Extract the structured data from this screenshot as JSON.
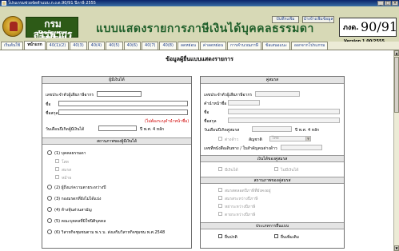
{
  "window": {
    "title": "โปรแกรมช่วยจัดทำแบบ ภ.ง.ด.90/91 ปีภาษี 2555"
  },
  "banner": {
    "org_th": "กรมสรรพากร",
    "org_en": "The Revenue Department",
    "form_title": "แบบแสดงรายการภาษีเงินได้บุคคลธรรมดา",
    "form_code_prefix": "ภงด.",
    "form_code": "90/91",
    "save_label": "บันทึกแฟ้ม",
    "attach_label": "นำเข้าแฟ้มข้อมูล",
    "version": "Version 1.00/2555"
  },
  "tabs": [
    {
      "label": "เริ่มต้นใช้",
      "active": false
    },
    {
      "label": "หน้าแรก",
      "active": true
    },
    {
      "label": "40(1)(2)",
      "active": false
    },
    {
      "label": "40(3)",
      "active": false
    },
    {
      "label": "40(4)",
      "active": false
    },
    {
      "label": "40(5)",
      "active": false
    },
    {
      "label": "40(6)",
      "active": false
    },
    {
      "label": "40(7)",
      "active": false
    },
    {
      "label": "40(8)",
      "active": false
    },
    {
      "label": "ลดหย่อน",
      "active": false
    },
    {
      "label": "ค่าลดหย่อน",
      "active": false
    },
    {
      "label": "การคำนวณภาษี",
      "active": false
    },
    {
      "label": "ข้อเสนอแนะ",
      "active": false
    },
    {
      "label": "ออกจากโปรแกรม",
      "active": false
    }
  ],
  "page": {
    "title": "ข้อมูลผู้ยื่นแบบแสดงรายการ",
    "taxpayer": {
      "header": "ผู้มีเงินได้",
      "tax_id_label": "เลขประจำตัวผู้เสียภาษีอากร",
      "name_label": "ชื่อ",
      "surname_label": "ชื่อสกุล",
      "note": "(ไม่ต้องระบุคำนำหน้าชื่อ)",
      "birth_label": "วันเดือนปีเกิดผู้มีเงินได้",
      "birth_hint": "ปี พ.ศ. 4 หลัก"
    },
    "status": {
      "header": "สถานภาพของผู้มีเงินได้",
      "options": [
        {
          "label": "(1) บุคคลธรรมดา"
        },
        {
          "label": "(2) ผู้ถึงแก่ความตายระหว่างปี"
        },
        {
          "label": "(3) กองมรดกที่ยังไม่ได้แบ่ง"
        },
        {
          "label": "(4) ห้างหุ้นส่วนสามัญ"
        },
        {
          "label": "(5) คณะบุคคลที่มิใช่นิติบุคคล"
        },
        {
          "label": "(6) วิสาหกิจชุมชนตาม พ.ร.บ. ส่งเสริมวิสาหกิจชุมชน พ.ศ.2548"
        }
      ],
      "sub_options": [
        {
          "label": "โสด"
        },
        {
          "label": "สมรส"
        },
        {
          "label": "หม้าย"
        }
      ]
    },
    "spouse": {
      "header": "คู่สมรส",
      "tax_id_label": "เลขประจำตัวผู้เสียภาษีอากร",
      "prefix_label": "คำนำหน้าชื่อ",
      "name_label": "ชื่อ",
      "surname_label": "ชื่อสกุล",
      "birth_label": "วันเดือนปีเกิดคู่สมรส",
      "birth_hint": "ปี พ.ศ. 4 หลัก",
      "foreign_label": "ต่างด้าว",
      "nationality_label": "สัญชาติ",
      "nationality_value": "ไทย",
      "passport_label": "เลขที่หนังสือเดินทาง / ใบสำคัญคนต่างด้าว"
    },
    "spouse_income": {
      "header": "เงินได้ของคู่สมรส",
      "options": [
        {
          "label": "มีเงินได้"
        },
        {
          "label": "ไม่มีเงินได้"
        }
      ]
    },
    "spouse_status": {
      "header": "สถานภาพของคู่สมรส",
      "options": [
        {
          "label": "สมรสตลอดปีภาษีที่ยังคงอยู่"
        },
        {
          "label": "สมรสระหว่างปีภาษี"
        },
        {
          "label": "หย่าระหว่างปีภาษี"
        },
        {
          "label": "ตายระหว่างปีภาษี"
        }
      ]
    },
    "filing_type": {
      "header": "ประเภทการยื่นแบบ",
      "options": [
        {
          "label": "ยื่นปกติ"
        },
        {
          "label": "ยื่นเพิ่มเติม"
        }
      ]
    }
  },
  "colors": {
    "banner": "#d7d9b6",
    "org_box": "#2d5a17",
    "title_green": "#1f5f2a",
    "note_red": "#d00000"
  }
}
